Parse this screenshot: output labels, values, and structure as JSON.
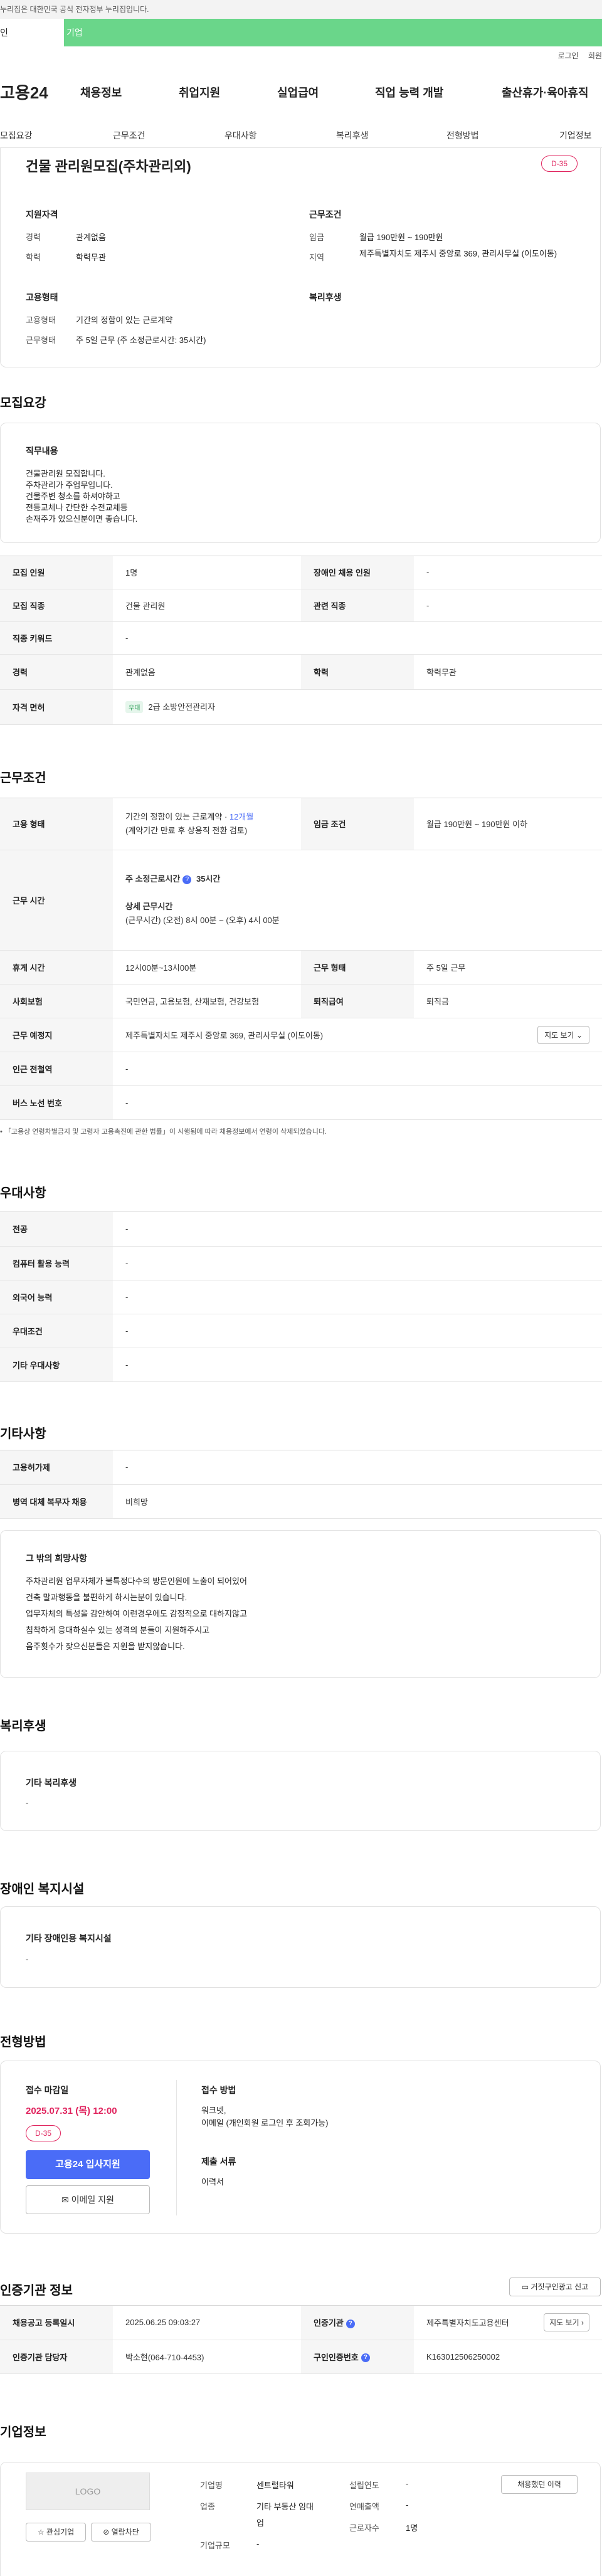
{
  "header": {
    "notice": "누리집은 대한민국 공식 전자정부 누리집입니다.",
    "tab_personal": "인",
    "tab_company": "기업",
    "login": "로그인",
    "signup": "회원",
    "logo": "고용24",
    "gnb": [
      "채용정보",
      "취업지원",
      "실업급여",
      "직업 능력 개발",
      "출산휴가·육아휴직"
    ],
    "subnav": [
      "모집요강",
      "근무조건",
      "우대사항",
      "복리후생",
      "전형방법",
      "기업정보"
    ]
  },
  "summary": {
    "title": "건물 관리원모집(주차관리외)",
    "dday": "D-35",
    "qual_title": "지원자격",
    "career_label": "경력",
    "career": "관계없음",
    "edu_label": "학력",
    "edu": "학력무관",
    "cond_title": "근무조건",
    "wage_label": "임금",
    "wage": "월급 190만원 ~ 190만원",
    "region_label": "지역",
    "region": "제주특별자치도 제주시 중앙로 369, 관리사무실 (이도이동)",
    "emp_title": "고용형태",
    "emptype_label": "고용형태",
    "emptype": "기간의 정함이 있는 근로계약",
    "worktype_label": "근무형태",
    "worktype": "주 5일 근무 (주 소정근로시간: 35시간)",
    "welfare_title": "복리후생"
  },
  "recruit": {
    "section": "모집요강",
    "duty_title": "직무내용",
    "duty_lines": [
      "건물관리원 모집합니다.",
      "주차관리가 주업무입니다.",
      "건물주변 청소를 하셔야하고",
      "전등교체나 간단한 수전교체등",
      "손재주가 있으신분이면 좋습니다."
    ],
    "rows": [
      {
        "k1": "모집 인원",
        "v1": "1명",
        "k2": "장애인 채용 인원",
        "v2": "-"
      },
      {
        "k1": "모집 직종",
        "v1": "건물 관리원",
        "k2": "관련 직종",
        "v2": "-"
      },
      {
        "k1": "직종 키워드",
        "v1": "-"
      },
      {
        "k1": "경력",
        "v1": "관계없음",
        "k2": "학력",
        "v2": "학력무관"
      },
      {
        "k1": "자격 면허",
        "v1": "2급 소방안전관리자",
        "tag": "우대"
      }
    ]
  },
  "work": {
    "section": "근무조건",
    "emp_k": "고용 형태",
    "emp_v1": "기간의 정함이 있는 근로계약 · ",
    "emp_link": "12개월",
    "emp_v2": "(계약기간 만료 후 상용직 전환 검토)",
    "wage_k": "임금 조건",
    "wage_v": "월급 190만원 ~ 190만원 이하",
    "hours_k": "근무 시간",
    "hours_total_label": "주 소정근로시간",
    "hours_total": "35시간",
    "hours_detail_label": "상세 근무시간",
    "hours_detail": "(근무시간) (오전) 8시 00분 ~ (오후) 4시 00분",
    "break_k": "휴게 시간",
    "break_v": "12시00분~13시00분",
    "form_k": "근무 형태",
    "form_v": "주 5일 근무",
    "ins_k": "사회보험",
    "ins_v": "국민연금, 고용보험, 산재보험, 건강보험",
    "sev_k": "퇴직급여",
    "sev_v": "퇴직금",
    "place_k": "근무 예정지",
    "place_v": "제주특별자치도 제주시 중앙로 369, 관리사무실 (이도이동)",
    "map_btn": "지도 보기",
    "subway_k": "인근 전철역",
    "subway_v": "-",
    "bus_k": "버스 노선 번호",
    "bus_v": "-",
    "note": "「고용상 연령차별금지 및 고령자 고용촉진에 관한 법률」이 시행됨에 따라 채용정보에서 연령이 삭제되었습니다."
  },
  "pref": {
    "section": "우대사항",
    "rows": [
      {
        "k": "전공",
        "v": "-"
      },
      {
        "k": "컴퓨터 활용 능력",
        "v": "-"
      },
      {
        "k": "외국어 능력",
        "v": "-"
      },
      {
        "k": "우대조건",
        "v": "-"
      },
      {
        "k": "기타 우대사항",
        "v": "-"
      }
    ]
  },
  "etc": {
    "section": "기타사항",
    "rows": [
      {
        "k": "고용허가제",
        "v": "-"
      },
      {
        "k": "병역 대체 복무자 채용",
        "v": "비희망"
      }
    ],
    "box_title": "그 밖의 희망사항",
    "box_lines": [
      "주차관리원 업무자체가 불특정다수의 방문인원에 노출이 되어있어",
      "건축 말과행동을 불편하게 하시는분이 있습니다.",
      "업무자체의 특성을 감안하여 이런경우에도 감정적으로 대하지않고",
      "침착하게 응대하실수 있는 성격의 분들이 지원해주시고",
      "음주횟수가 잦으신분들은 지원을 받지않습니다."
    ]
  },
  "welfare": {
    "section": "복리후생",
    "box_title": "기타 복리후생",
    "box_v": "-"
  },
  "disabled": {
    "section": "장애인 복지시설",
    "box_title": "기타 장애인용 복지시설",
    "box_v": "-"
  },
  "process": {
    "section": "전형방법",
    "deadline_label": "접수 마감일",
    "deadline": "2025.07.31 (목) 12:00",
    "dday": "D-35",
    "apply_btn": "고용24 입사지원",
    "email_btn": "이메일 지원",
    "method_label": "접수 방법",
    "method_1": "워크넷,",
    "method_2": "이메일 (개인회원 로그인 후 조회가능)",
    "docs_label": "제출 서류",
    "docs": "이력서"
  },
  "agency": {
    "section": "인증기관 정보",
    "report_btn": "거짓구인광고 신고",
    "reg_k": "채용공고 등록일시",
    "reg_v": "2025.06.25 09:03:27",
    "org_k": "인증기관",
    "org_v": "제주특별자치도고용센터",
    "map_btn": "지도 보기",
    "mgr_k": "인증기관 담당자",
    "mgr_v": "박소현(064-710-4453)",
    "no_k": "구인인증번호",
    "no_v": "K163012506250002"
  },
  "company": {
    "section": "기업정보",
    "logo": "LOGO",
    "fav_btn": "관심기업",
    "block_btn": "열람차단",
    "name_k": "기업명",
    "name_v": "센트럴타워",
    "ind_k": "업종",
    "ind_v1": "기타 부동산 임대",
    "ind_v2": "업",
    "size_k": "기업규모",
    "size_v": "-",
    "year_k": "설립연도",
    "year_v": "-",
    "sales_k": "연매출액",
    "sales_v": "-",
    "staff_k": "근로자수",
    "staff_v": "1명",
    "history_btn": "채용했던 이력"
  }
}
